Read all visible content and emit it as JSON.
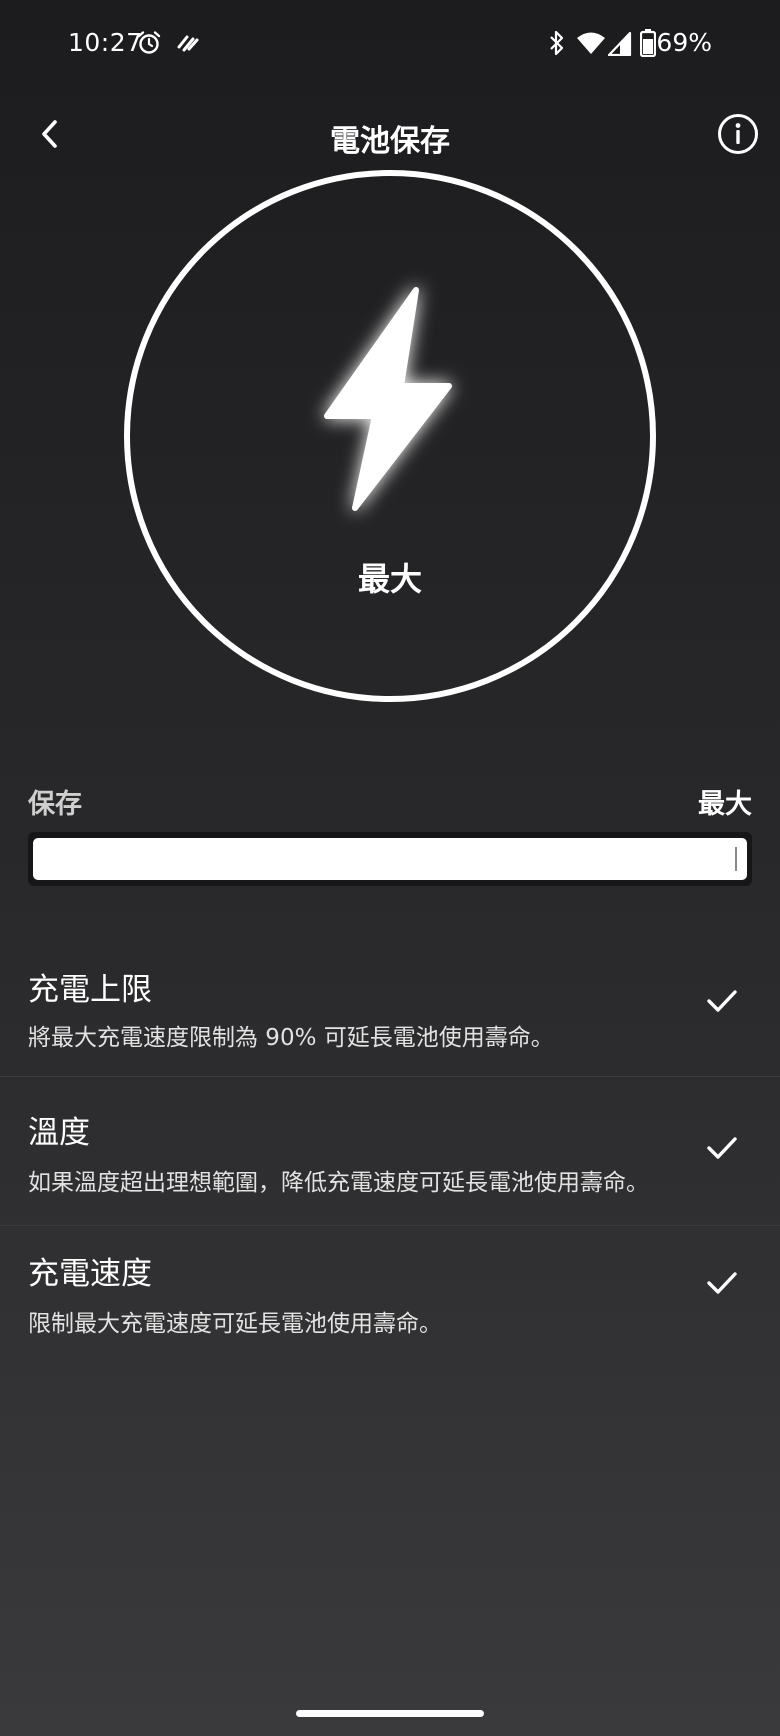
{
  "status_bar": {
    "time": "10:27",
    "battery_percent": "69%",
    "icons": [
      "alarm-icon",
      "vpn-icon",
      "bluetooth-icon",
      "wifi-icon",
      "cellular-signal-icon",
      "battery-icon"
    ]
  },
  "header": {
    "title": "電池保存",
    "back_icon": "chevron-left-icon",
    "info_icon": "info-icon"
  },
  "dial": {
    "icon": "lightning-bolt-icon",
    "label": "最大"
  },
  "slider": {
    "min_label": "保存",
    "max_label": "最大",
    "value_fraction": 1.0
  },
  "features": [
    {
      "title": "充電上限",
      "description": "將最大充電速度限制為 90% 可延長電池使用壽命。",
      "checked": true
    },
    {
      "title": "溫度",
      "description": "如果溫度超出理想範圍，降低充電速度可延長電池使用壽命。",
      "checked": true
    },
    {
      "title": "充電速度",
      "description": "限制最大充電速度可延長電池使用壽命。",
      "checked": true
    }
  ],
  "colors": {
    "background_top": "#1c1c1e",
    "background_bottom": "#3a3a3c",
    "accent": "#ffffff",
    "divider": "#3c3c3e"
  }
}
